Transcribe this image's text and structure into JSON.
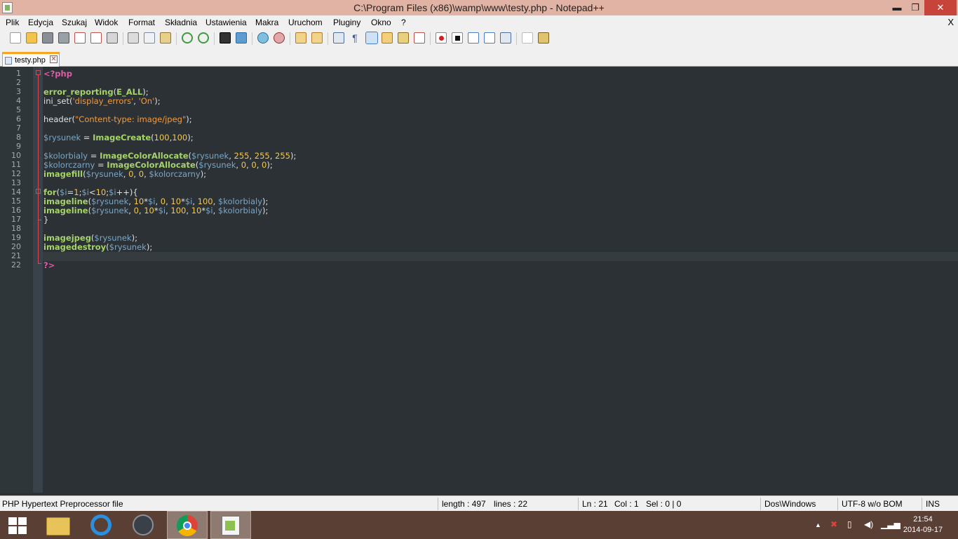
{
  "window": {
    "title": "C:\\Program Files (x86)\\wamp\\www\\testy.php - Notepad++",
    "min_glyph": "▬",
    "max_glyph": "❐",
    "close_glyph": "✕"
  },
  "menu": {
    "items": [
      "Plik",
      "Edycja",
      "Szukaj",
      "Widok",
      "Format",
      "Składnia",
      "Ustawienia",
      "Makra",
      "Uruchom",
      "Pluginy",
      "Okno",
      "?"
    ],
    "close_doc": "X"
  },
  "toolbar": {
    "icons": [
      "new-file-icon",
      "open-file-icon",
      "save-icon",
      "save-all-icon",
      "close-icon",
      "close-all-icon",
      "print-icon",
      "cut-icon",
      "copy-icon",
      "paste-icon",
      "undo-icon",
      "redo-icon",
      "find-icon",
      "replace-icon",
      "zoom-in-icon",
      "zoom-out-icon",
      "sync-vertical-icon",
      "sync-horizontal-icon",
      "word-wrap-icon",
      "show-all-chars-icon",
      "indent-guide-icon",
      "user-lang-icon",
      "doc-map-icon",
      "function-list-icon",
      "record-macro-icon",
      "stop-macro-icon",
      "play-macro-icon",
      "run-macro-multiple-icon",
      "save-macro-icon",
      "spell-check-icon",
      "plugin-icon"
    ],
    "active": "indent-guide-icon"
  },
  "tab": {
    "label": "testy.php",
    "close": "✕"
  },
  "editor": {
    "line_numbers": [
      "1",
      "2",
      "3",
      "4",
      "5",
      "6",
      "7",
      "8",
      "9",
      "10",
      "11",
      "12",
      "13",
      "14",
      "15",
      "16",
      "17",
      "18",
      "19",
      "20",
      "21",
      "22"
    ],
    "current_line": "21",
    "colors": {
      "background": "#2b3134",
      "php_tag": "#e05ba8",
      "function": "#a6d36a",
      "variable": "#7ba7c6",
      "string": "#f39a3f",
      "number": "#f5c850",
      "fold_marker": "#d8484d"
    }
  },
  "status": {
    "file_type": "PHP Hypertext Preprocessor file",
    "length": "length : 497",
    "lines": "lines : 22",
    "ln": "Ln : 21",
    "col": "Col : 1",
    "sel": "Sel : 0 | 0",
    "eol": "Dos\\Windows",
    "encoding": "UTF-8 w/o BOM",
    "mode": "INS"
  },
  "taskbar": {
    "apps": [
      "file-explorer-icon",
      "internet-explorer-icon",
      "media-app-icon",
      "chrome-icon",
      "notepadpp-icon"
    ],
    "active_app": "notepadpp-icon",
    "time": "21:54",
    "date": "2014-09-17"
  }
}
